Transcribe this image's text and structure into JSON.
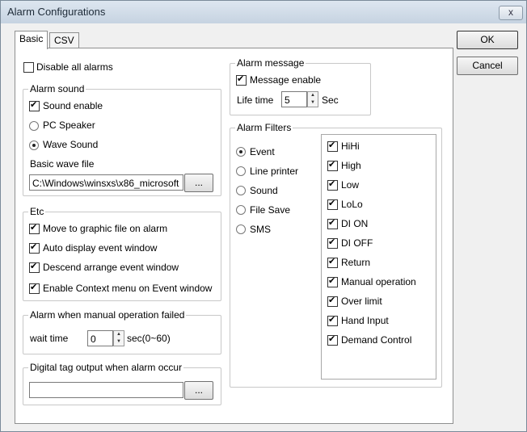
{
  "window": {
    "title": "Alarm Configurations",
    "close_label": "x"
  },
  "tabs": [
    {
      "label": "Basic"
    },
    {
      "label": "CSV"
    }
  ],
  "buttons": {
    "ok": "OK",
    "cancel": "Cancel"
  },
  "disable_all": {
    "label": "Disable all alarms",
    "checked": false
  },
  "alarm_sound": {
    "group_label": "Alarm sound",
    "sound_enable": {
      "label": "Sound enable",
      "checked": true
    },
    "pc_speaker": {
      "label": "PC Speaker",
      "selected": false
    },
    "wave_sound": {
      "label": "Wave Sound",
      "selected": true
    },
    "wave_file_label": "Basic wave file",
    "wave_file_value": "C:\\Windows\\winsxs\\x86_microsoft",
    "browse_label": "..."
  },
  "etc": {
    "group_label": "Etc",
    "items": [
      {
        "label": "Move to graphic file on alarm",
        "checked": true
      },
      {
        "label": "Auto display event window",
        "checked": true
      },
      {
        "label": "Descend arrange event window",
        "checked": true
      },
      {
        "label": "Enable Context menu on Event window",
        "checked": true
      }
    ]
  },
  "manual_fail": {
    "group_label": "Alarm when manual operation failed",
    "wait_label": "wait time",
    "wait_value": "0",
    "unit": "sec(0~60)"
  },
  "digital_tag": {
    "group_label": "Digital tag output when alarm occur",
    "value": "",
    "browse_label": "..."
  },
  "alarm_message": {
    "group_label": "Alarm message",
    "message_enable": {
      "label": "Message enable",
      "checked": true
    },
    "life_label": "Life time",
    "life_value": "5",
    "unit": "Sec"
  },
  "alarm_filters": {
    "group_label": "Alarm Filters",
    "radios": [
      {
        "label": "Event",
        "selected": true
      },
      {
        "label": "Line printer",
        "selected": false
      },
      {
        "label": "Sound",
        "selected": false
      },
      {
        "label": "File Save",
        "selected": false
      },
      {
        "label": "SMS",
        "selected": false
      }
    ],
    "levels": [
      {
        "label": "HiHi",
        "checked": true
      },
      {
        "label": "High",
        "checked": true
      },
      {
        "label": "Low",
        "checked": true
      },
      {
        "label": "LoLo",
        "checked": true
      },
      {
        "label": "DI ON",
        "checked": true
      },
      {
        "label": "DI OFF",
        "checked": true
      },
      {
        "label": "Return",
        "checked": true
      },
      {
        "label": "Manual operation",
        "checked": true
      },
      {
        "label": "Over limit",
        "checked": true
      },
      {
        "label": "Hand Input",
        "checked": true
      },
      {
        "label": "Demand Control",
        "checked": true
      }
    ]
  }
}
